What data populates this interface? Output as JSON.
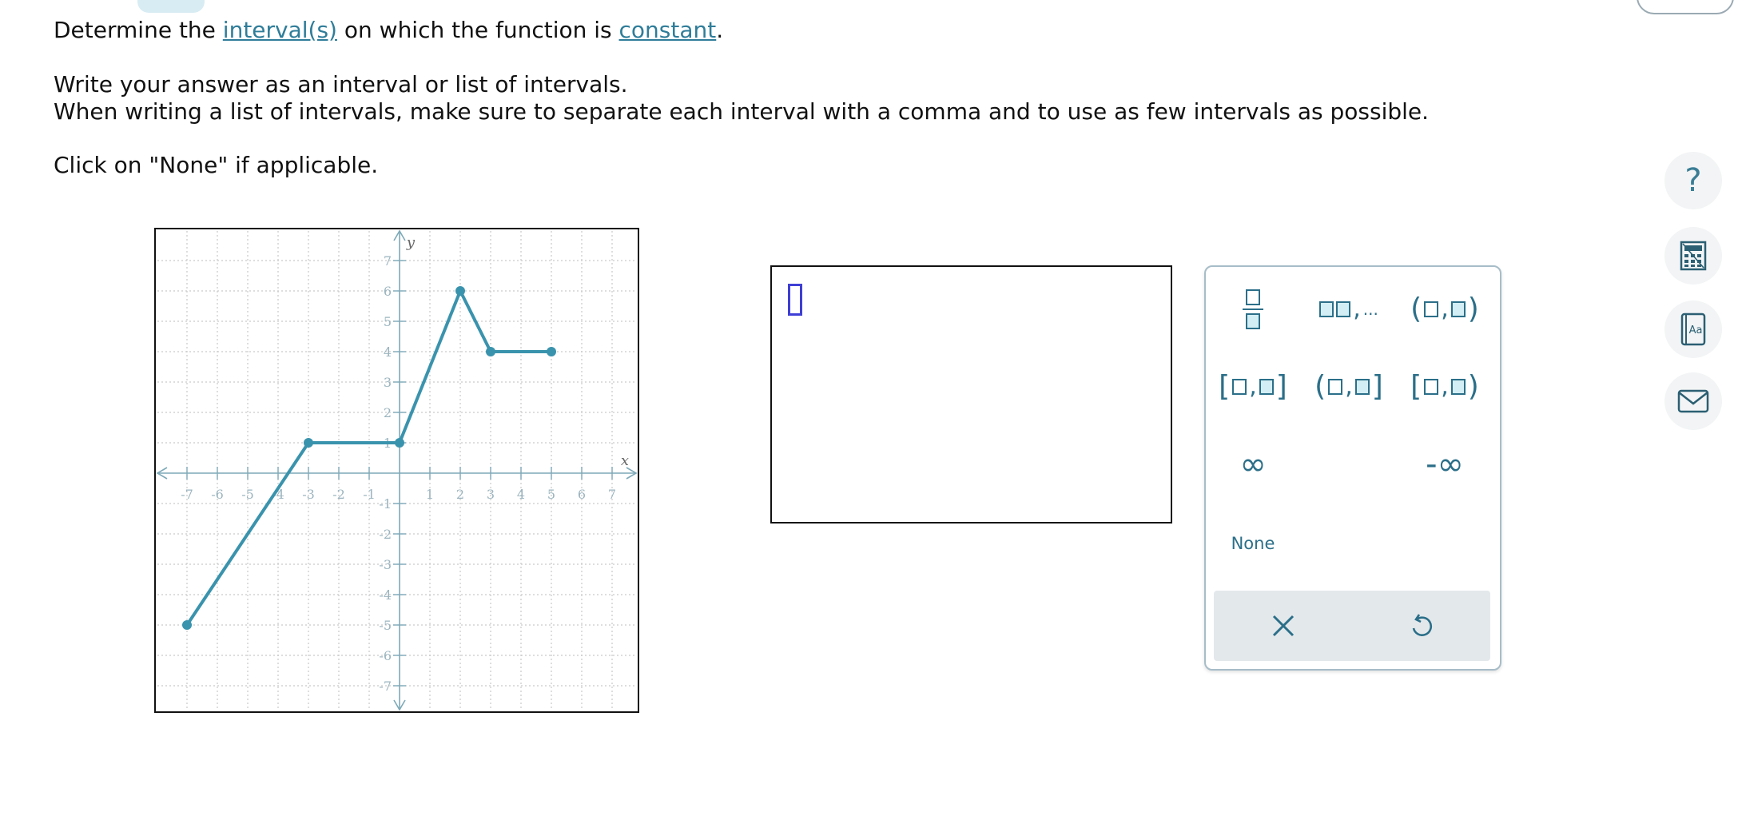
{
  "question": {
    "line1": {
      "pre": "Determine the ",
      "link1": "interval(s)",
      "mid": " on which the function is ",
      "link2": "constant",
      "post": "."
    },
    "line2": "Write your answer as an interval or list of intervals.",
    "line3": "When writing a list of intervals, make sure to separate each interval with a comma and to use as few intervals as possible.",
    "line4": "Click on \"None\" if applicable."
  },
  "graph": {
    "x_label": "x",
    "y_label": "y",
    "x_ticks": [
      "-7",
      "-6",
      "-5",
      "-4",
      "-3",
      "-2",
      "-1",
      "1",
      "2",
      "3",
      "4",
      "5",
      "6",
      "7"
    ],
    "y_ticks": [
      "7",
      "6",
      "5",
      "4",
      "3",
      "2",
      "1",
      "-1",
      "-2",
      "-3",
      "-4",
      "-5",
      "-6",
      "-7"
    ],
    "xlim": [
      -7.5,
      7.5
    ],
    "ylim": [
      -7.5,
      7.5
    ],
    "line_color": "#3a93ad",
    "points": [
      [
        -7,
        -5
      ],
      [
        -3,
        1
      ],
      [
        0,
        1
      ],
      [
        2,
        6
      ],
      [
        3,
        4
      ],
      [
        5,
        4
      ]
    ]
  },
  "keypad": {
    "none_label": "None",
    "fraction_icon": "fraction-icon",
    "list_icon": "list-icon",
    "list_ellipsis": "...",
    "infinity": "∞",
    "neg_infinity": "-∞",
    "open_open": [
      "(",
      ")"
    ],
    "closed_closed": [
      "[",
      "]"
    ],
    "open_closed": [
      "(",
      "]"
    ],
    "closed_open": [
      "[",
      ")"
    ],
    "comma": ",",
    "clear_icon": "close-icon",
    "undo_icon": "undo-icon"
  },
  "sidebar": {
    "help_glyph": "?",
    "calculator_icon": "calculator-icon",
    "dictionary_icon": "dictionary-icon",
    "dictionary_text": "Aa",
    "mail_icon": "mail-icon"
  }
}
